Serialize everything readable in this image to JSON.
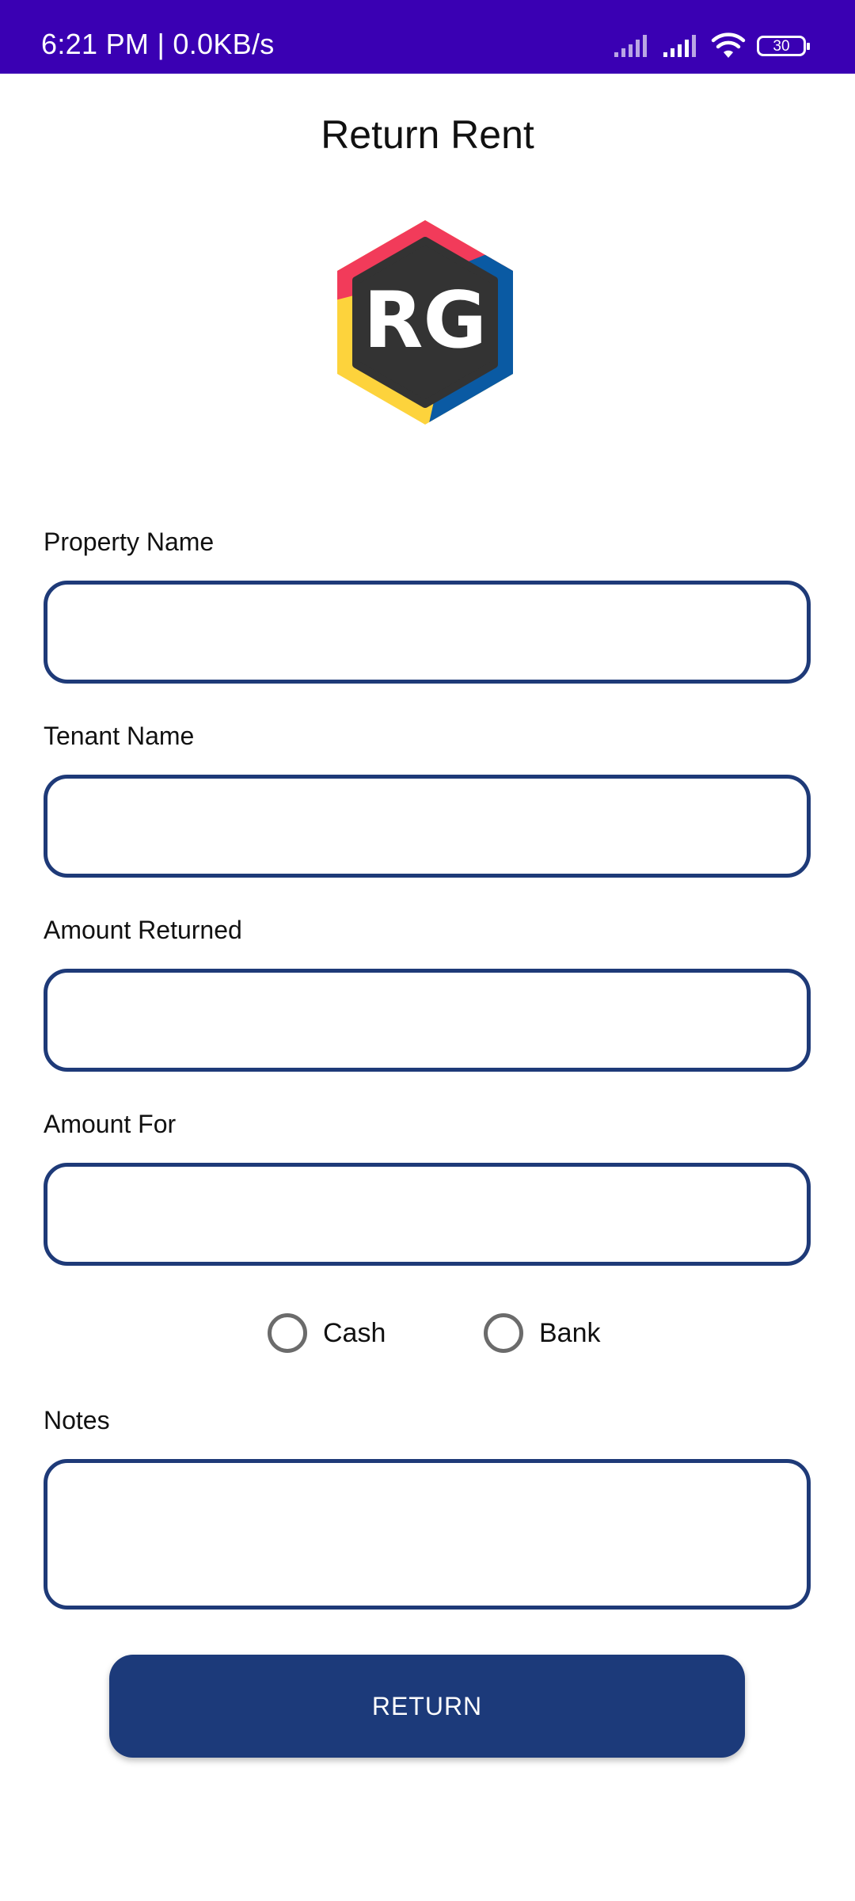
{
  "status_bar": {
    "time_speed": "6:21 PM | 0.0KB/s",
    "battery": "30",
    "icons": [
      "signal-icon",
      "signal-icon",
      "wifi-icon",
      "battery-icon"
    ],
    "background_color": "#3a00b3"
  },
  "header": {
    "title": "Return Rent"
  },
  "logo": {
    "text": "RG",
    "colors": [
      "#f23b5a",
      "#0a5aa3",
      "#fdd33c",
      "#333333"
    ]
  },
  "form": {
    "property_name": {
      "label": "Property Name",
      "value": ""
    },
    "tenant_name": {
      "label": "Tenant Name",
      "value": ""
    },
    "amount_returned": {
      "label": "Amount Returned",
      "value": ""
    },
    "amount_for": {
      "label": "Amount For",
      "value": ""
    },
    "payment_mode": {
      "options": [
        "Cash",
        "Bank"
      ],
      "selected": null
    },
    "notes": {
      "label": "Notes",
      "value": ""
    }
  },
  "actions": {
    "return_label": "RETURN"
  },
  "colors": {
    "primary": "#1c3a7a",
    "field_border": "#1e3a78"
  }
}
